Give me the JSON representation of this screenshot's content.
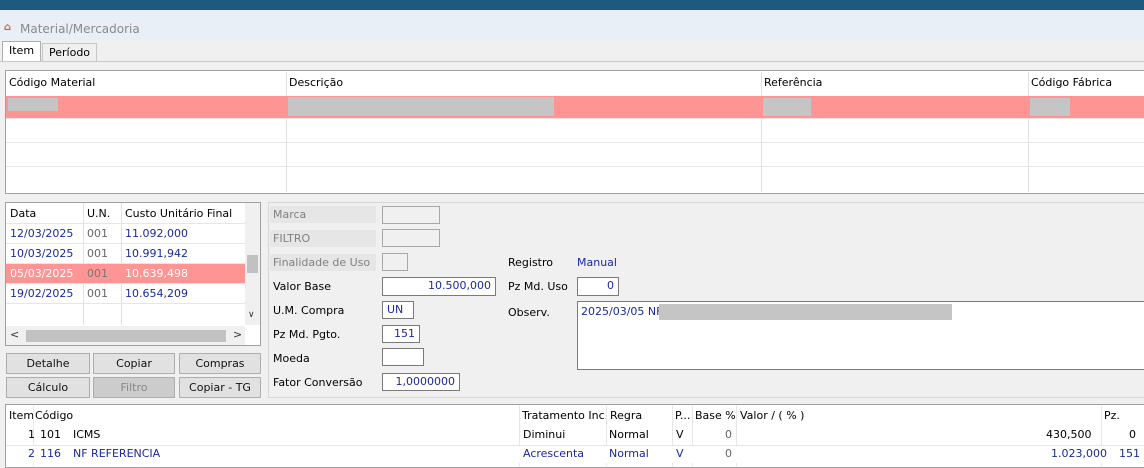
{
  "window": {
    "title": "Material/Mercadoria",
    "icon": "app-icon"
  },
  "tabs": [
    {
      "label": "Item"
    },
    {
      "label": "Período"
    }
  ],
  "top_grid": {
    "columns": [
      "Código Material",
      "Descrição",
      "Referência",
      "Código Fábrica"
    ],
    "selected_row_color": "#ff9494"
  },
  "history": {
    "columns": [
      "Data",
      "U.N.",
      "Custo Unitário Final"
    ],
    "rows": [
      {
        "data": "12/03/2025",
        "un": "001",
        "custo": "11.092,000"
      },
      {
        "data": "10/03/2025",
        "un": "001",
        "custo": "10.991,942"
      },
      {
        "data": "05/03/2025",
        "un": "001",
        "custo": "10.639,498"
      },
      {
        "data": "19/02/2025",
        "un": "001",
        "custo": "10.654,209"
      }
    ]
  },
  "buttons": {
    "detalhe": "Detalhe",
    "copiar": "Copiar",
    "compras": "Compras",
    "calculo": "Cálculo",
    "filtro": "Filtro",
    "copiar_tg": "Copiar - TG"
  },
  "form": {
    "marca_label": "Marca",
    "filtro_label": "FILTRO",
    "finalidade_label": "Finalidade de Uso",
    "valor_base_label": "Valor Base",
    "valor_base": "10.500,000",
    "um_compra_label": "U.M. Compra",
    "um_compra": "UN",
    "pz_md_pgto_label": "Pz Md. Pgto.",
    "pz_md_pgto": "151",
    "moeda_label": "Moeda",
    "fator_label": "Fator Conversão",
    "fator": "1,0000000",
    "registro_label": "Registro",
    "registro": "Manual",
    "pz_md_uso_label": "Pz Md. Uso",
    "pz_md_uso": "0",
    "observ_label": "Observ.",
    "observ": "2025/03/05 NF:"
  },
  "taxes": {
    "columns": {
      "item": "Item",
      "codigo": "Código",
      "tratamento": "Tratamento Inc.",
      "regra": "Regra",
      "p": "P...",
      "base": "Base %",
      "valor": "Valor / ( % )",
      "pz": "Pz."
    },
    "rows": [
      {
        "item": "1",
        "codigo": "101",
        "nome": "ICMS",
        "tratamento": "Diminui",
        "regra": "Normal",
        "p": "V",
        "base": "0",
        "valor": "430,500",
        "pz": "0"
      },
      {
        "item": "2",
        "codigo": "116",
        "nome": "NF REFERENCIA",
        "tratamento": "Acrescenta",
        "regra": "Normal",
        "p": "V",
        "base": "0",
        "valor": "1.023,000",
        "pz": "151"
      }
    ]
  }
}
